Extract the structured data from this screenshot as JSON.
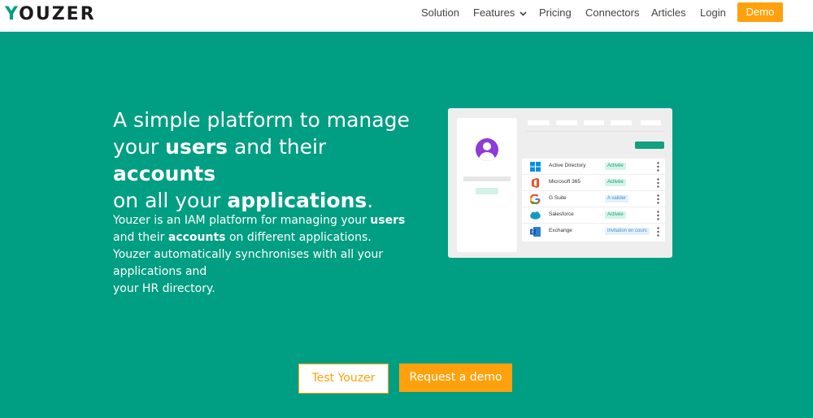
{
  "brand": {
    "name_rest": "OUZER",
    "name_first": "Y"
  },
  "nav": {
    "items": [
      "Solution",
      "Features",
      "Pricing",
      "Connectors",
      "Articles",
      "Login"
    ],
    "demo_label": "Demo"
  },
  "hero": {
    "title_1": "A simple platform to manage",
    "title_2a": "your ",
    "title_2b": "users",
    "title_2c": " and their ",
    "title_2d": "accounts",
    "title_3a": "on all your ",
    "title_3b": "applications",
    "title_3c": ".",
    "desc_1a": "Youzer is an IAM platform for managing your ",
    "desc_1b": "users",
    "desc_2a": "and their ",
    "desc_2b": "accounts",
    "desc_2c": " on different applications.",
    "desc_3": "Youzer automatically synchronises with all your applications and",
    "desc_4": "your HR directory."
  },
  "mockup": {
    "apps": [
      {
        "name": "Active Directory",
        "status": "Activée",
        "state": "ok",
        "icon": "windows-icon"
      },
      {
        "name": "Microsoft 365",
        "status": "Activée",
        "state": "ok",
        "icon": "office-icon"
      },
      {
        "name": "G Suite",
        "status": "A valider",
        "state": "pend",
        "icon": "google-icon"
      },
      {
        "name": "Salesforce",
        "status": "Activée",
        "state": "ok",
        "icon": "salesforce-icon"
      },
      {
        "name": "Exchange",
        "status": "Invitation en cours",
        "state": "pend",
        "icon": "exchange-icon"
      }
    ]
  },
  "cta": {
    "test_label": "Test Youzer",
    "demo_label": "Request a demo"
  },
  "colors": {
    "teal": "#009e82",
    "orange": "#ffa10c",
    "purple": "#8e3bd8"
  }
}
